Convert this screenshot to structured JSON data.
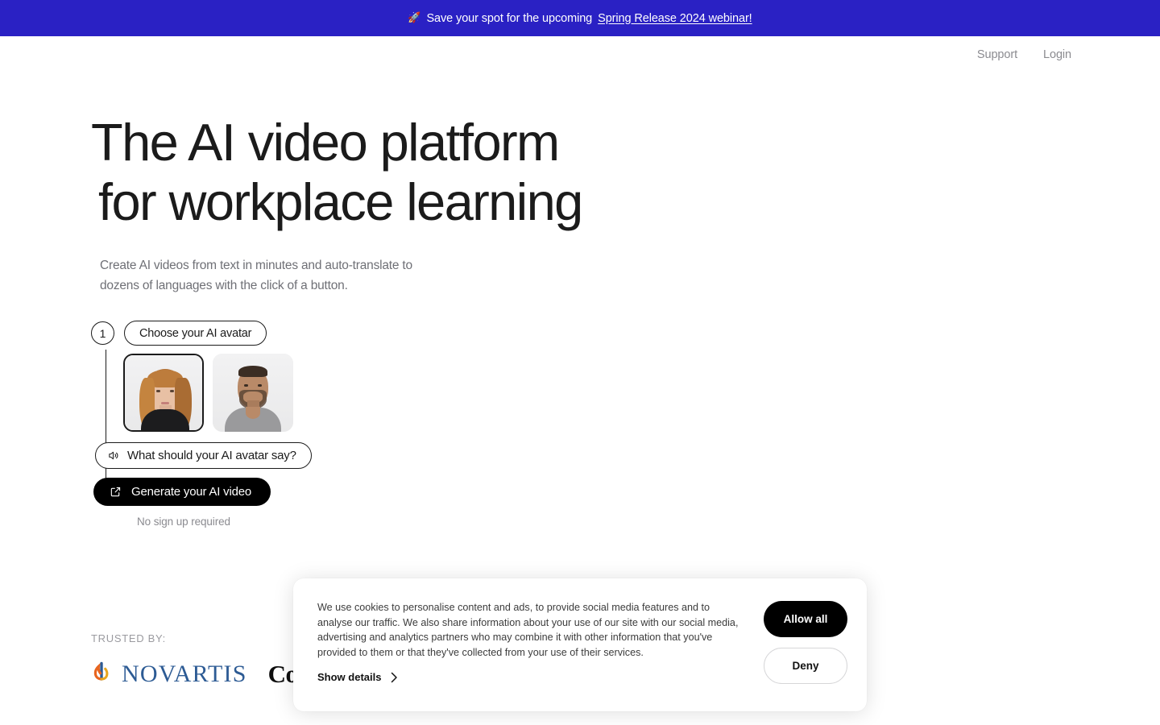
{
  "banner": {
    "icon": "rocket-icon",
    "text": "Save your spot for the upcoming ",
    "link_label": "Spring Release 2024 webinar!",
    "background_color": "#2A21C4"
  },
  "header": {
    "nav": [
      {
        "label": "Support"
      },
      {
        "label": "Login"
      }
    ]
  },
  "hero": {
    "headline_line1": "The AI video platform",
    "headline_line2": "for workplace learning",
    "subhead_line1": "Create AI videos from text in minutes and auto-translate to",
    "subhead_line2": "dozens of languages with the click of a button."
  },
  "widget": {
    "step_number": "1",
    "step_label": "Choose your AI avatar",
    "avatars": [
      {
        "name": "female-avatar",
        "selected": true
      },
      {
        "name": "male-avatar",
        "selected": false
      }
    ],
    "say_icon": "speaker-icon",
    "say_label": "What should your AI avatar say?",
    "cta_icon": "external-link-icon",
    "cta_label": "Generate your AI video",
    "cta_background": "#000000",
    "note": "No sign up required"
  },
  "trusted": {
    "label": "TRUSTED BY:",
    "logos": [
      {
        "name": "novartis-logo",
        "text": "NOVARTIS",
        "color": "#2d5b94"
      },
      {
        "name": "continental-logo",
        "text": "Continental",
        "color": "#0d0d0d"
      }
    ]
  },
  "cookie": {
    "text": "We use cookies to personalise content and ads, to provide social media features and to analyse our traffic. We also share information about your use of our site with our social media, advertising and analytics partners who may combine it with other information that you've provided to them or that they've collected from your use of their services.",
    "show_details_label": "Show details",
    "allow_label": "Allow all",
    "deny_label": "Deny"
  }
}
